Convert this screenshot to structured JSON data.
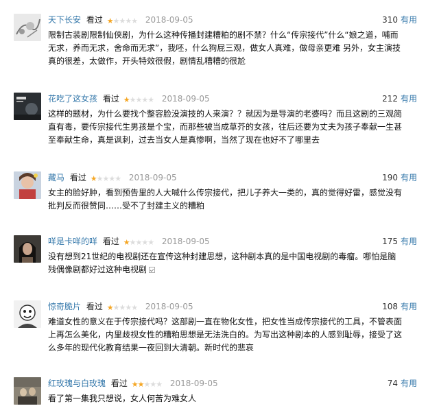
{
  "reviews": [
    {
      "user": "天下长安",
      "status": "看过",
      "rating": 1,
      "date": "2018-09-05",
      "votes": "310",
      "useful_label": "有用",
      "text": "限制古装剧限制仙侠剧，为什么这种传播封建糟粕的剧不禁？什么“传宗接代”什么“娘之道，哺而无求，养而无求，舍命而无求”，我呸，什么狗屁三观，做女人真难，做母亲更难 另外，女主演技真的很差，太做作，开头特效很假，剧情乱糟糟的很尬",
      "avatar_icon": "gray-flower-avatar"
    },
    {
      "user": "花吃了这女孩",
      "status": "看过",
      "rating": 1,
      "date": "2018-09-05",
      "votes": "212",
      "useful_label": "有用",
      "text": "这样的题材，为什么要找个整容脸没演技的人来演？？就因为是导演的老婆吗？而且这剧的三观简直有毒，要传宗接代生男孩是个宝，而那些被当成草芥的女孩，往后还要为丈夫为孩子奉献一生甚至奉献生命，真是讽刺，过去当女人是真惨啊，当然了现在也好不了哪里去",
      "avatar_icon": "dark-poster-avatar"
    },
    {
      "user": "藏马",
      "status": "看过",
      "rating": 1,
      "date": "2018-09-05",
      "votes": "190",
      "useful_label": "有用",
      "text": "女主的脸好肿，看到预告里的人大喊什么传宗接代，把儿子养大一类的，真的觉得好雷，感觉没有批判反而很赞同……受不了封建主义的糟粕",
      "avatar_icon": "colorful-anime-avatar"
    },
    {
      "user": "咩是卡咩的咩",
      "status": "看过",
      "rating": 1,
      "date": "2018-09-05",
      "votes": "175",
      "useful_label": "有用",
      "text": "没有想到21世纪的电视剧还在宣传这种封建思想，这种剧本真的是中国电视剧的毒瘤。哪怕是脑残偶像剧都好过这种电视剧",
      "expandable": true,
      "avatar_icon": "woman-portrait-avatar"
    },
    {
      "user": "惊奇脆片",
      "status": "看过",
      "rating": 1,
      "date": "2018-09-05",
      "votes": "108",
      "useful_label": "有用",
      "text": "难道女性的意义在于传宗接代吗？这部剧一直在物化女性，把女性当成传宗接代的工具，不管表面上再怎么美化，内里歧视女性的糟粕思想是无法洗白的。为写出这种剧本的人感到耻辱，接受了这么多年的现代化教育结果一夜回到大清朝。新时代的悲哀",
      "avatar_icon": "bw-cartoon-avatar"
    },
    {
      "user": "红玫瑰与白玫瑰",
      "status": "看过",
      "rating": 2,
      "date": "2018-09-05",
      "votes": "74",
      "useful_label": "有用",
      "text": "看了第一集我只想说，女人何苦为难女人",
      "avatar_icon": "old-photo-avatar"
    }
  ]
}
